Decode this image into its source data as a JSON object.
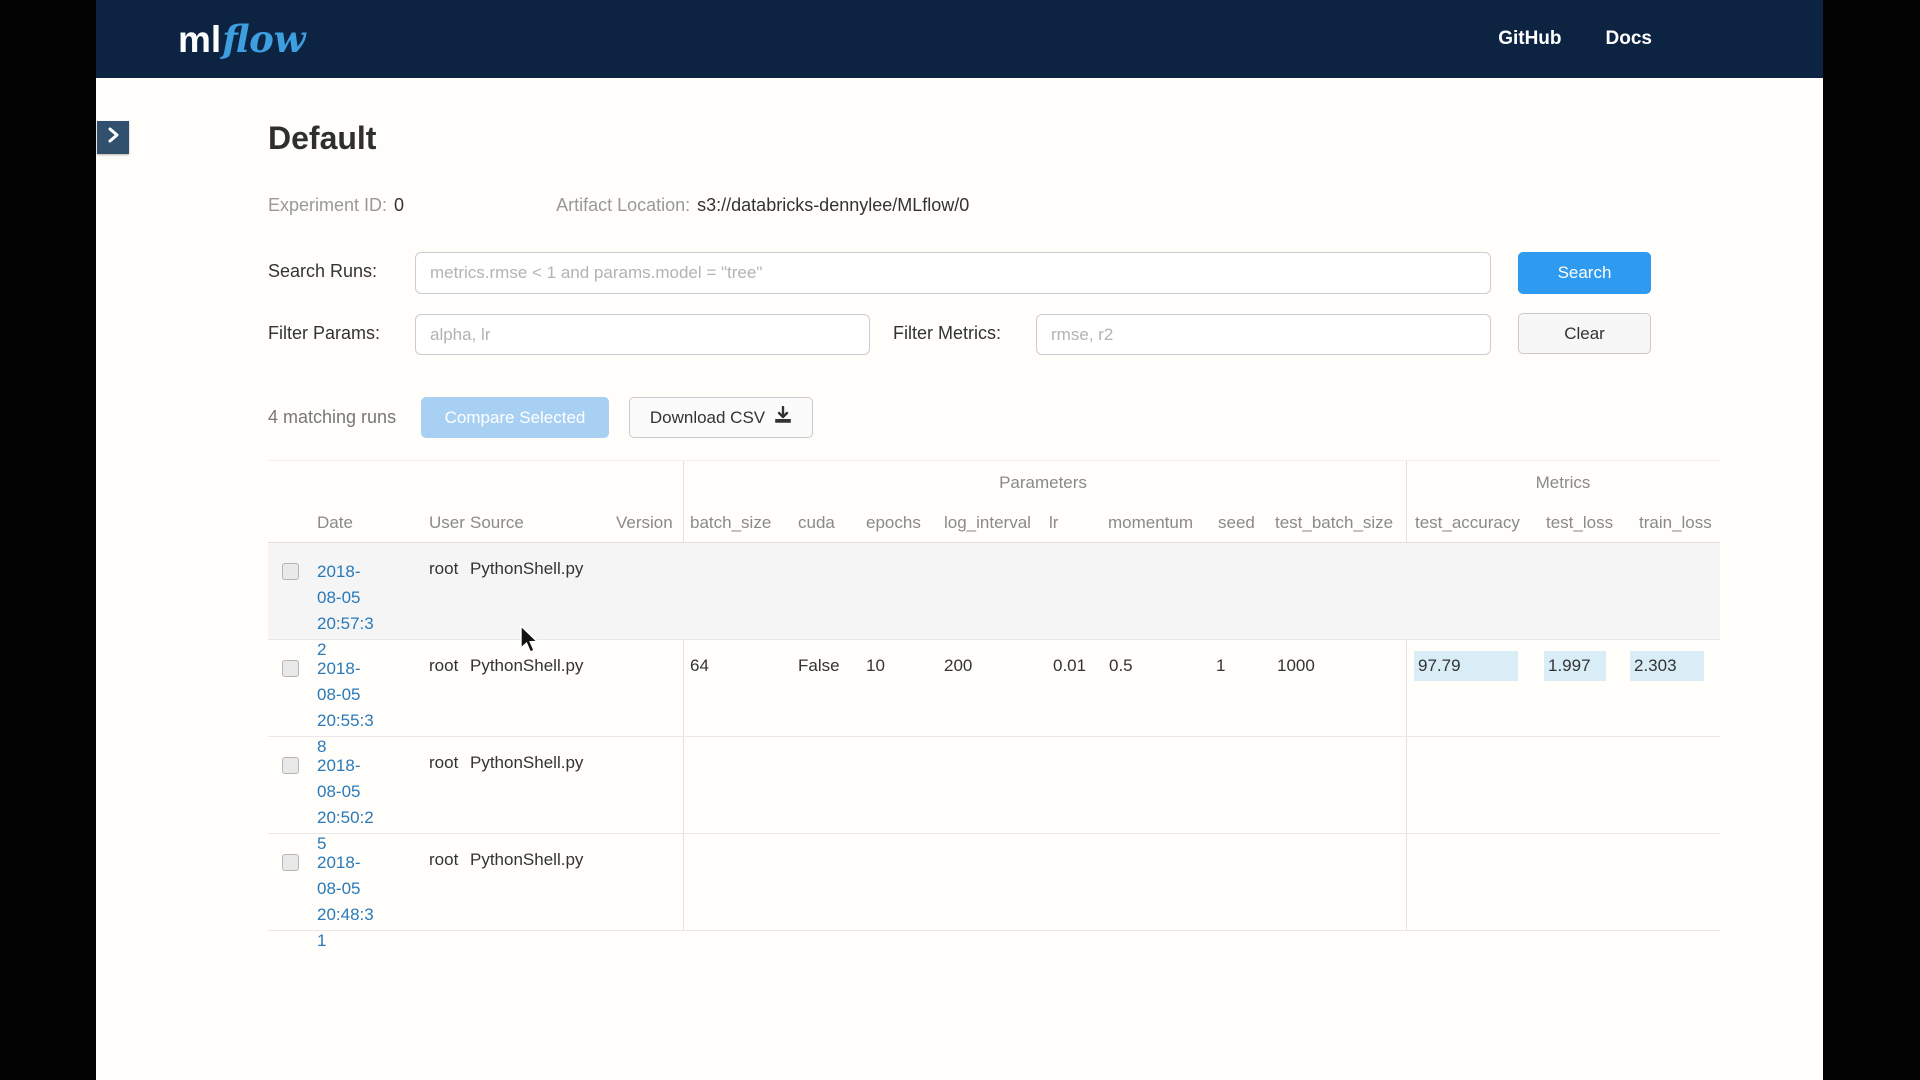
{
  "navbar": {
    "logo_ml": "ml",
    "logo_flow": "flow",
    "links": [
      {
        "label": "GitHub"
      },
      {
        "label": "Docs"
      }
    ]
  },
  "experiment": {
    "title": "Default",
    "id_label": "Experiment ID:",
    "id_value": "0",
    "artifact_label": "Artifact Location:",
    "artifact_value": "s3://databricks-dennylee/MLflow/0"
  },
  "search": {
    "label": "Search Runs:",
    "placeholder": "metrics.rmse < 1 and params.model = \"tree\"",
    "button_label": "Search"
  },
  "filters": {
    "params_label": "Filter Params:",
    "params_placeholder": "alpha, lr",
    "metrics_label": "Filter Metrics:",
    "metrics_placeholder": "rmse, r2",
    "clear_label": "Clear"
  },
  "runs_bar": {
    "matching_text": "4 matching runs",
    "compare_label": "Compare Selected",
    "download_label": "Download CSV"
  },
  "table": {
    "group_headers": {
      "parameters": "Parameters",
      "metrics": "Metrics"
    },
    "base_columns": {
      "date": "Date",
      "user": "User",
      "source": "Source",
      "version": "Version"
    },
    "param_columns": [
      "batch_size",
      "cuda",
      "epochs",
      "log_interval",
      "lr",
      "momentum",
      "seed",
      "test_batch_size"
    ],
    "metric_columns": [
      "test_accuracy",
      "test_loss",
      "train_loss"
    ],
    "rows": [
      {
        "date": "2018-08-05 20:57:32",
        "user": "root",
        "source": "PythonShell.py",
        "params": [
          "",
          "",
          "",
          "",
          "",
          "",
          "",
          ""
        ],
        "metrics": [
          "",
          "",
          ""
        ]
      },
      {
        "date": "2018-08-05 20:55:38",
        "user": "root",
        "source": "PythonShell.py",
        "params": [
          "64",
          "False",
          "10",
          "200",
          "0.01",
          "0.5",
          "1",
          "1000"
        ],
        "metrics": [
          "97.79",
          "1.997",
          "2.303"
        ]
      },
      {
        "date": "2018-08-05 20:50:25",
        "user": "root",
        "source": "PythonShell.py",
        "params": [
          "",
          "",
          "",
          "",
          "",
          "",
          "",
          ""
        ],
        "metrics": [
          "",
          "",
          ""
        ]
      },
      {
        "date": "2018-08-05 20:48:31",
        "user": "root",
        "source": "PythonShell.py",
        "params": [
          "",
          "",
          "",
          "",
          "",
          "",
          "",
          ""
        ],
        "metrics": [
          "",
          "",
          ""
        ]
      }
    ]
  },
  "colors": {
    "navbar_bg": "#0d2342",
    "accent_blue": "#2e9bf0",
    "link_blue": "#2a7ab9",
    "metric_highlight": "#d9edf7",
    "disabled_button": "#a7d0f2"
  }
}
